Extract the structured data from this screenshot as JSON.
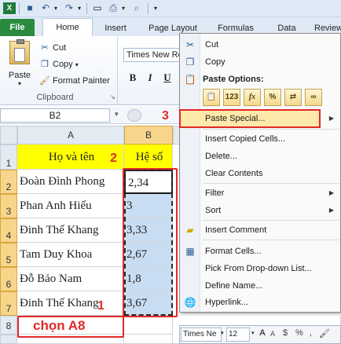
{
  "ribbon": {
    "tabs": [
      "File",
      "Home",
      "Insert",
      "Page Layout",
      "Formulas",
      "Data",
      "Review"
    ],
    "clipboard": {
      "paste": "Paste",
      "cut": "Cut",
      "copy": "Copy",
      "format_painter": "Format Painter",
      "group_label": "Clipboard"
    },
    "font_name": "Times New Ro",
    "bold": "B",
    "italic": "I",
    "underline": "U"
  },
  "name_box": "B2",
  "columns": [
    "A",
    "B"
  ],
  "rows": [
    "1",
    "2",
    "3",
    "4",
    "5",
    "6",
    "7",
    "8"
  ],
  "table": {
    "header": [
      "Họ và tên",
      "Hệ số"
    ],
    "names": [
      "Đoàn Đình Phong",
      "Phan Anh Hiếu",
      "Đinh Thế Khang",
      "Tam Duy Khoa",
      "Đỗ Bảo Nam",
      "Đinh Thế Khang"
    ],
    "values": [
      "2,34",
      "3",
      "3,33",
      "2,67",
      "1,8",
      "3,67"
    ]
  },
  "annotations": {
    "step1": "1",
    "step2": "2",
    "step3": "3",
    "select_a8": "chọn A8"
  },
  "context_menu": {
    "cut": "Cut",
    "copy": "Copy",
    "paste_options": "Paste Options:",
    "paste_option_icons": [
      "paste-icon",
      "values-123-icon",
      "formulas-fx-icon",
      "percent-format-icon",
      "transpose-icon",
      "link-icon"
    ],
    "paste_special": "Paste Special...",
    "insert_copied_cells": "Insert Copied Cells...",
    "delete": "Delete...",
    "clear_contents": "Clear Contents",
    "filter": "Filter",
    "sort": "Sort",
    "insert_comment": "Insert Comment",
    "format_cells": "Format Cells...",
    "pick_from_list": "Pick From Drop-down List...",
    "define_name": "Define Name...",
    "hyperlink": "Hyperlink..."
  },
  "mini_toolbar": {
    "font": "Times Ne",
    "size": "12"
  },
  "colors": {
    "file_tab": "#2a8a3e",
    "header_fill": "#ffff00",
    "selection_fill": "#c9ddf2",
    "annotation_red": "#e02828",
    "menu_highlight": "#fde9a9"
  }
}
